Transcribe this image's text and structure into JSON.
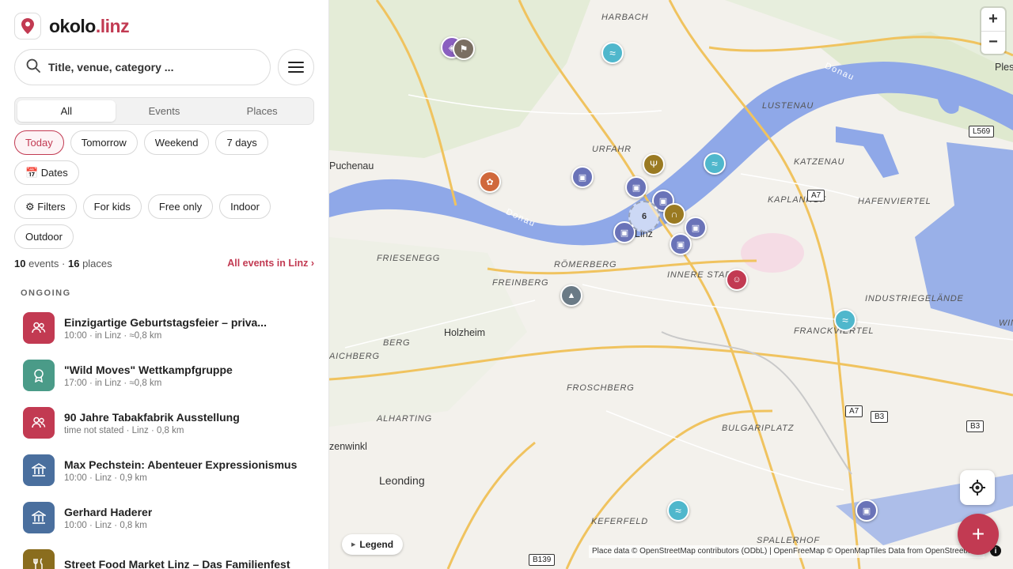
{
  "brand": {
    "name": "okolo",
    "tld": ".linz"
  },
  "search": {
    "placeholder": "Title, venue, category ..."
  },
  "tabs": [
    {
      "label": "All",
      "active": true
    },
    {
      "label": "Events",
      "active": false
    },
    {
      "label": "Places",
      "active": false
    }
  ],
  "time_chips": [
    {
      "label": "Today",
      "active": true
    },
    {
      "label": "Tomorrow",
      "active": false
    },
    {
      "label": "Weekend",
      "active": false
    },
    {
      "label": "7 days",
      "active": false
    }
  ],
  "dates_chip": {
    "label": "📅 Dates"
  },
  "filter_chips": [
    {
      "label": "⚙ Filters"
    },
    {
      "label": "For kids"
    },
    {
      "label": "Free only"
    },
    {
      "label": "Indoor"
    }
  ],
  "outdoor_chip": {
    "label": "Outdoor"
  },
  "summary": {
    "events_count": "10",
    "events_word": "events ·",
    "places_count": "16",
    "places_word": "places",
    "all_link": "All events in Linz"
  },
  "section": {
    "ongoing": "ONGOING"
  },
  "events": [
    {
      "title": "Einzigartige Geburtstagsfeier – priva...",
      "meta": "10:00 · in Linz · ≈0,8 km",
      "color": "#c23a52",
      "icon": "people-icon"
    },
    {
      "title": "\"Wild Moves\" Wettkampfgruppe",
      "meta": "17:00 · in Linz · ≈0,8 km",
      "color": "#4a9b88",
      "icon": "medal-icon"
    },
    {
      "title": "90 Jahre Tabakfabrik Ausstellung",
      "meta": "time not stated · Linz · 0,8 km",
      "color": "#c23a52",
      "icon": "people-icon"
    },
    {
      "title": "Max Pechstein: Abenteuer Expressionismus",
      "meta": "10:00 · Linz · 0,9 km",
      "color": "#4a6f9e",
      "icon": "museum-icon"
    },
    {
      "title": "Gerhard Haderer",
      "meta": "10:00 · Linz · 0,8 km",
      "color": "#4a6f9e",
      "icon": "museum-icon"
    },
    {
      "title": "Street Food Market Linz – Das Familienfest",
      "meta": "",
      "color": "#8a6d1e",
      "icon": "food-icon"
    }
  ],
  "map": {
    "places": [
      {
        "name": "HARBACH"
      },
      {
        "name": "Pleschi"
      },
      {
        "name": "LUSTENAU"
      },
      {
        "name": "L569"
      },
      {
        "name": "URFAHR"
      },
      {
        "name": "Puchenau"
      },
      {
        "name": "KATZENAU"
      },
      {
        "name": "KAPLANHOF"
      },
      {
        "name": "A7"
      },
      {
        "name": "HAFENVIERTEL"
      },
      {
        "name": "Linz"
      },
      {
        "name": "FRIESENEGG"
      },
      {
        "name": "RÖMERBERG"
      },
      {
        "name": "INNERE STADT"
      },
      {
        "name": "FREINBERG"
      },
      {
        "name": "INDUSTRIEGELÄNDE"
      },
      {
        "name": "Holzheim"
      },
      {
        "name": "BERG"
      },
      {
        "name": "FRANCKVIERTEL"
      },
      {
        "name": "AICHBERG"
      },
      {
        "name": "WIN"
      },
      {
        "name": "FROSCHBERG"
      },
      {
        "name": "ALHARTING"
      },
      {
        "name": "A7"
      },
      {
        "name": "B3"
      },
      {
        "name": "B3"
      },
      {
        "name": "BULGARIPLATZ"
      },
      {
        "name": "Leonding"
      },
      {
        "name": "zenwinkl"
      },
      {
        "name": "KEFERFELD"
      },
      {
        "name": "SPALLERHOF"
      },
      {
        "name": "B139"
      }
    ],
    "river": "Donau",
    "cluster_count": "6",
    "legend": "Legend",
    "attribution": "Place data © OpenStreetMap contributors (ODbL) | OpenFreeMap © OpenMapTiles Data from OpenStreetMap",
    "zoom_in": "+",
    "zoom_out": "−",
    "fab_label": "+",
    "info": "i"
  }
}
